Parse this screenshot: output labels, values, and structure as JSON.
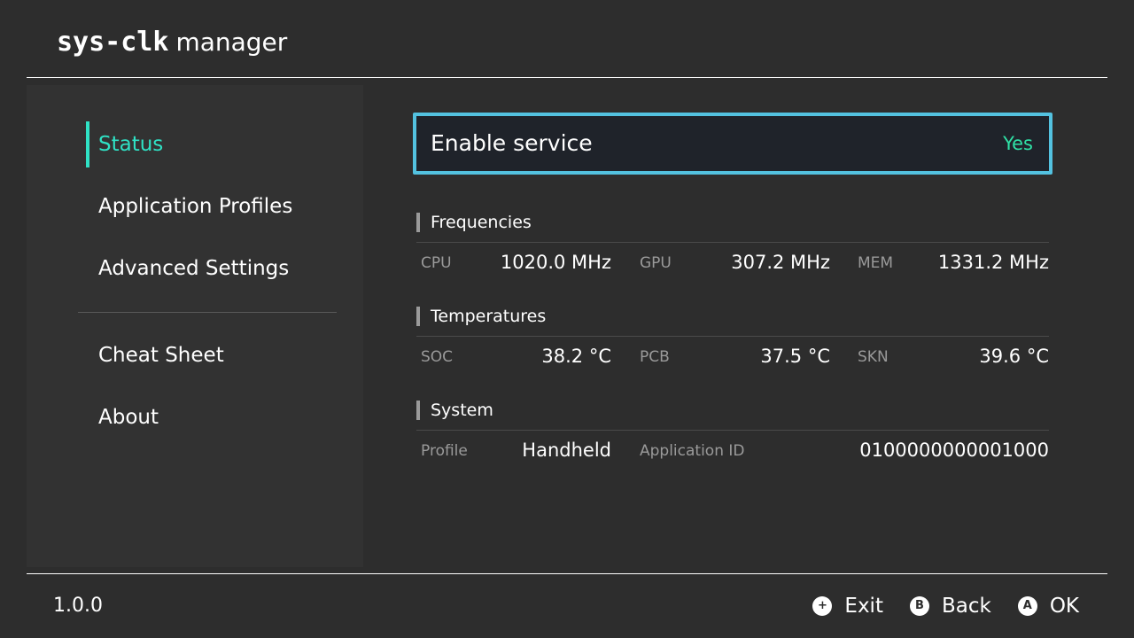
{
  "header": {
    "title_brand": "sys-clk",
    "title_sub": "manager"
  },
  "sidebar": {
    "items": [
      {
        "label": "Status",
        "active": true
      },
      {
        "label": "Application Profiles",
        "active": false
      },
      {
        "label": "Advanced Settings",
        "active": false
      },
      {
        "label": "Cheat Sheet",
        "active": false
      },
      {
        "label": "About",
        "active": false
      }
    ]
  },
  "main": {
    "enable_service": {
      "label": "Enable service",
      "value": "Yes"
    },
    "frequencies": {
      "title": "Frequencies",
      "cells": [
        {
          "label": "CPU",
          "value": "1020.0 MHz"
        },
        {
          "label": "GPU",
          "value": "307.2 MHz"
        },
        {
          "label": "MEM",
          "value": "1331.2 MHz"
        }
      ]
    },
    "temperatures": {
      "title": "Temperatures",
      "cells": [
        {
          "label": "SOC",
          "value": "38.2 °C"
        },
        {
          "label": "PCB",
          "value": "37.5 °C"
        },
        {
          "label": "SKN",
          "value": "39.6 °C"
        }
      ]
    },
    "system": {
      "title": "System",
      "profile_label": "Profile",
      "profile_value": "Handheld",
      "app_id_label": "Application ID",
      "app_id_value": "0100000000001000"
    }
  },
  "footer": {
    "version": "1.0.0",
    "actions": [
      {
        "button": "+",
        "label": "Exit",
        "icon": "plus-button-icon"
      },
      {
        "button": "B",
        "label": "Back",
        "icon": "b-button-icon"
      },
      {
        "button": "A",
        "label": "OK",
        "icon": "a-button-icon"
      }
    ]
  },
  "colors": {
    "background": "#2d2d2d",
    "sidebar": "#323232",
    "accent": "#2fe2c5",
    "focus_border": "#53c2e0",
    "value_green": "#2fe2a6"
  }
}
